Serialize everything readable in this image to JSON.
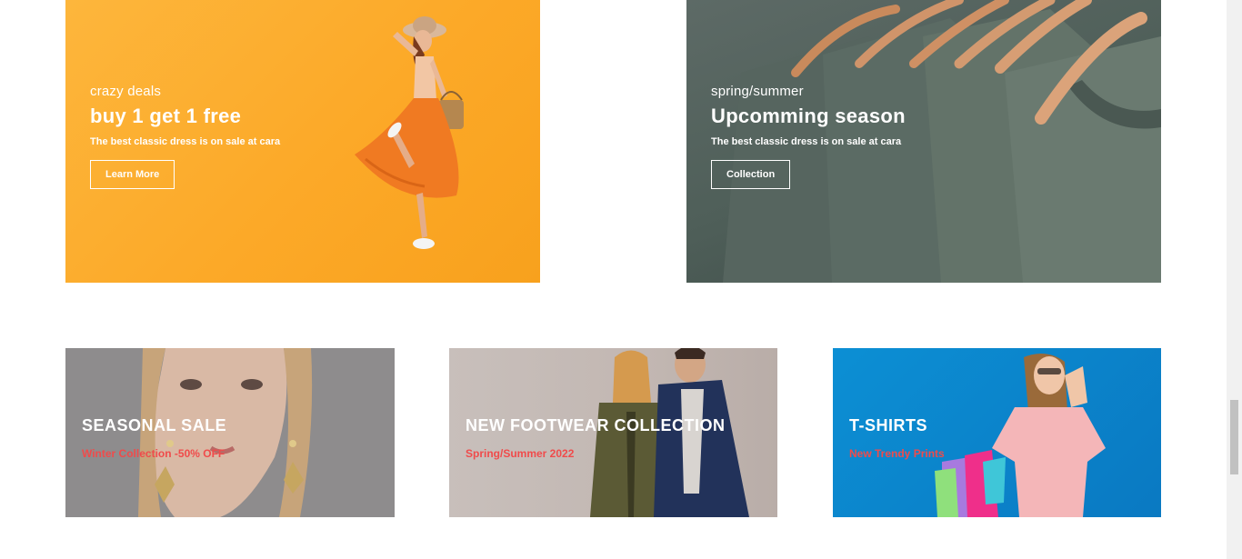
{
  "banners": [
    {
      "subtitle": "crazy deals",
      "title": "buy 1 get 1 free",
      "description": "The best classic dress is on sale at cara",
      "button": "Learn More"
    },
    {
      "subtitle": "spring/summer",
      "title": "Upcomming season",
      "description": "The best classic dress is on sale at cara",
      "button": "Collection"
    }
  ],
  "small_banners": [
    {
      "title": "SEASONAL SALE",
      "subtitle": "Winter Collection -50% OFF"
    },
    {
      "title": "NEW FOOTWEAR COLLECTION",
      "subtitle": "Spring/Summer 2022"
    },
    {
      "title": "T-SHIRTS",
      "subtitle": "New Trendy Prints"
    }
  ],
  "colors": {
    "orange_banner": "#fca928",
    "green_banner": "#4f5f59",
    "accent_red": "#f04b4b",
    "blue_banner": "#0a79c2"
  }
}
